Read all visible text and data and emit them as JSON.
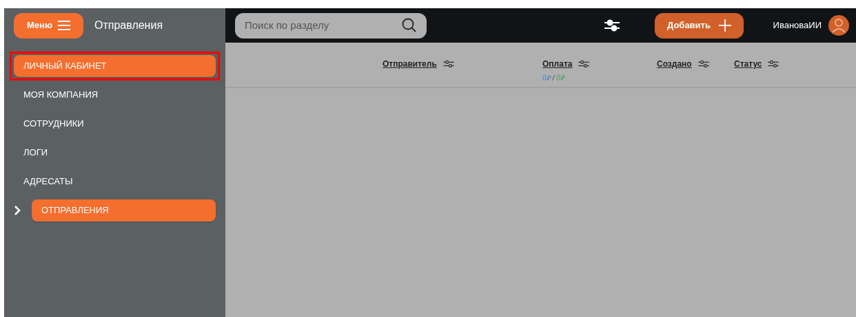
{
  "sidebar": {
    "menu_button": "Меню",
    "title": "Отправления",
    "items": [
      {
        "label": "ЛИЧНЫЙ КАБИНЕТ",
        "selected": true,
        "highlighted": true,
        "arrow": false
      },
      {
        "label": "МОЯ КОМПАНИЯ",
        "selected": false,
        "highlighted": false,
        "arrow": false
      },
      {
        "label": "СОТРУДНИКИ",
        "selected": false,
        "highlighted": false,
        "arrow": false
      },
      {
        "label": "ЛОГИ",
        "selected": false,
        "highlighted": false,
        "arrow": false
      },
      {
        "label": "АДРЕСАТЫ",
        "selected": false,
        "highlighted": false,
        "arrow": false
      },
      {
        "label": "ОТПРАВЛЕНИЯ",
        "selected": true,
        "highlighted": false,
        "arrow": true
      }
    ]
  },
  "topbar": {
    "search": {
      "placeholder": "Поиск по разделу"
    },
    "add_button": "Добавить",
    "user": "ИвановаИИ"
  },
  "table": {
    "columns": [
      {
        "label": "Отправитель"
      },
      {
        "label": "Оплата",
        "totals": [
          {
            "text": "0₽",
            "color": "#3b7fc4"
          },
          {
            "text": "0₽",
            "color": "#3f9a5c"
          }
        ],
        "totals_separator": "/"
      },
      {
        "label": "Создано"
      },
      {
        "label": "Статус"
      }
    ]
  }
}
